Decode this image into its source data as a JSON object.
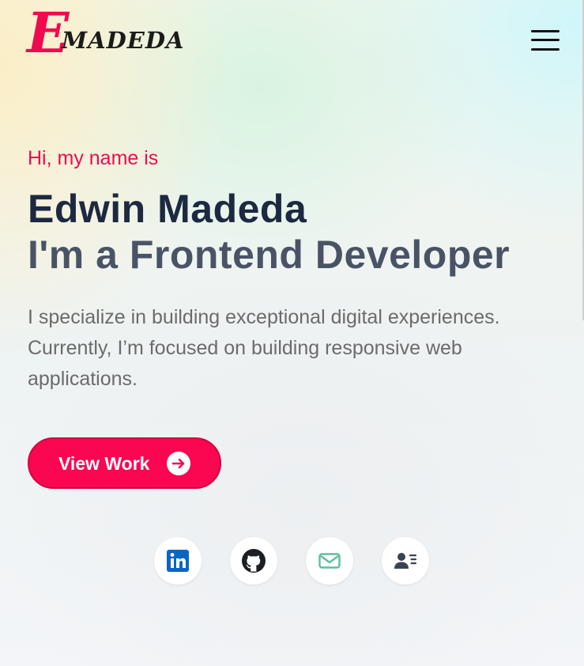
{
  "header": {
    "logo_initial": "E",
    "logo_rest": "MADEDA",
    "menu_icon": "hamburger-menu-icon"
  },
  "hero": {
    "greeting": "Hi, my name is",
    "name": "Edwin Madeda",
    "role": "I'm a Frontend Developer",
    "description": "I specialize in building exceptional digital experiences. Currently, I’m focused on building responsive web applications."
  },
  "cta": {
    "label": "View Work",
    "icon": "arrow-right-circle-icon"
  },
  "socials": [
    {
      "icon": "linkedin-icon",
      "color": "#0a66c2"
    },
    {
      "icon": "github-icon",
      "color": "#1b1f23"
    },
    {
      "icon": "mail-icon",
      "color": "#5bbf9f"
    },
    {
      "icon": "contact-card-icon",
      "color": "#3b4252"
    }
  ],
  "colors": {
    "accent": "#fb0651",
    "heading": "#1c2940",
    "subheading": "#4a5366",
    "body_text": "#6b6b6b"
  }
}
